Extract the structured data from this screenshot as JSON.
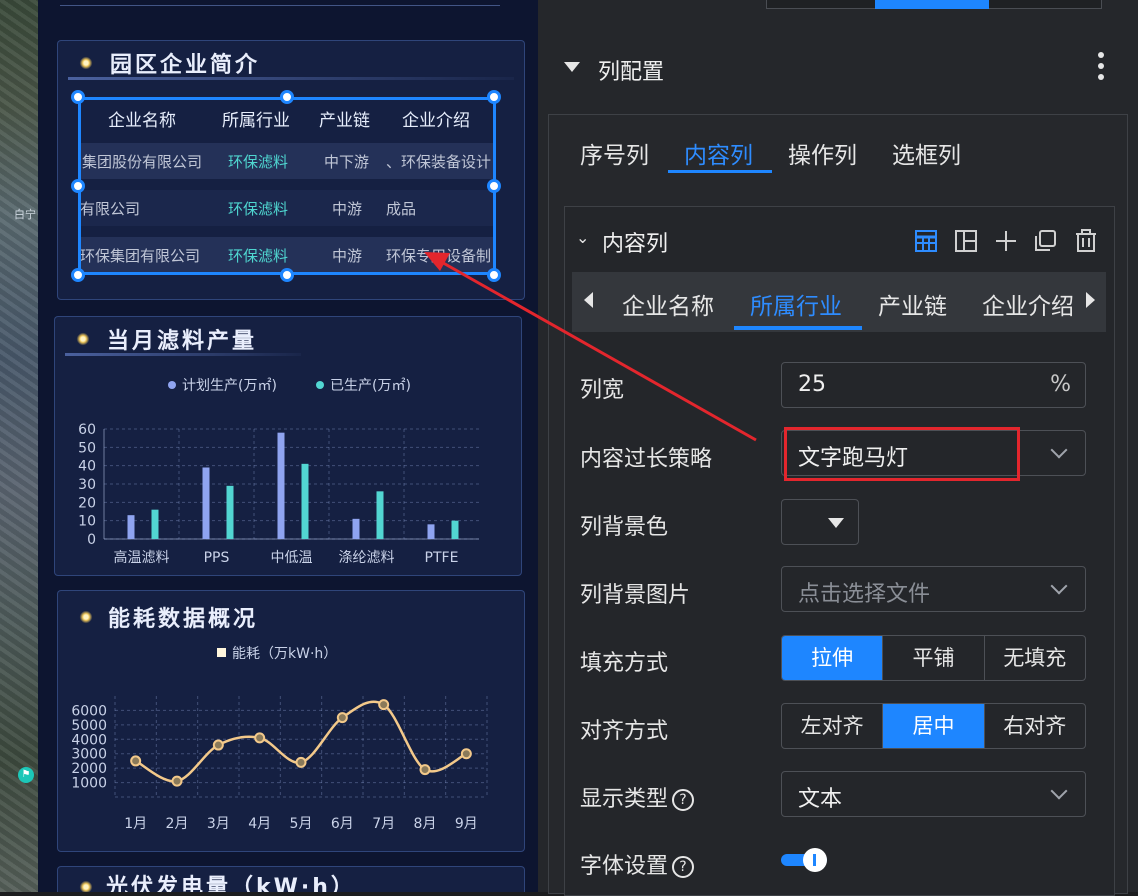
{
  "canvas": {
    "map_label": "白宁",
    "map_pin_glyph": "⚑",
    "company_panel": {
      "title": "园区企业简介",
      "headers": [
        "企业名称",
        "所属行业",
        "产业链",
        "企业介绍"
      ],
      "rows": [
        {
          "name": "集团股份有限公司",
          "industry": "环保滤料",
          "chain": "中下游",
          "intro": "、环保装备设计"
        },
        {
          "name": "有限公司",
          "industry": "环保滤料",
          "chain": "中游",
          "intro": "成品"
        },
        {
          "name": "环保集团有限公司",
          "industry": "环保滤料",
          "chain": "中游",
          "intro": "环保专用设备制"
        }
      ]
    },
    "filter_panel": {
      "title": "当月滤料产量"
    },
    "energy_panel": {
      "title": "能耗数据概况"
    },
    "pv_panel": {
      "title": "光伏发电量（kW·h）"
    }
  },
  "chart_data": [
    {
      "type": "bar",
      "legend_placement": "top",
      "categories": [
        "高温滤料",
        "PPS",
        "中低温",
        "涤纶滤料",
        "PTFE"
      ],
      "series": [
        {
          "name": "计划生产(万㎡)",
          "color": "#8fa4f0",
          "values": [
            13,
            39,
            58,
            11,
            8
          ]
        },
        {
          "name": "已生产(万㎡)",
          "color": "#52d6d2",
          "values": [
            16,
            29,
            41,
            26,
            10
          ]
        }
      ],
      "ylim": [
        0,
        60
      ],
      "yticks": [
        0,
        10,
        20,
        30,
        40,
        50,
        60
      ],
      "grid": true
    },
    {
      "type": "line",
      "legend_placement": "top",
      "categories": [
        "1月",
        "2月",
        "3月",
        "4月",
        "5月",
        "6月",
        "7月",
        "8月",
        "9月"
      ],
      "series": [
        {
          "name": "能耗（万kW·h）",
          "color": "#f3c98a",
          "values": [
            2500,
            1100,
            3600,
            4100,
            2400,
            5500,
            6400,
            1900,
            3000
          ]
        }
      ],
      "ylim": [
        0,
        7000
      ],
      "yticks": [
        1000,
        2000,
        3000,
        4000,
        5000,
        6000
      ],
      "grid": true
    }
  ],
  "config": {
    "section_title": "列配置",
    "tabs": [
      {
        "label": "序号列"
      },
      {
        "label": "内容列"
      },
      {
        "label": "操作列"
      },
      {
        "label": "选框列"
      }
    ],
    "inner_title": "内容列",
    "column_tabs": [
      {
        "label": "企业名称"
      },
      {
        "label": "所属行业"
      },
      {
        "label": "产业链"
      },
      {
        "label": "企业介绍"
      }
    ],
    "fields": {
      "width_label": "列宽",
      "width_value": "25",
      "width_unit": "%",
      "overflow_label": "内容过长策略",
      "overflow_value": "文字跑马灯",
      "bg_color_label": "列背景色",
      "bg_image_label": "列背景图片",
      "bg_image_placeholder": "点击选择文件",
      "fill_label": "填充方式",
      "fill_options": [
        "拉伸",
        "平铺",
        "无填充"
      ],
      "align_label": "对齐方式",
      "align_options": [
        "左对齐",
        "居中",
        "右对齐"
      ],
      "display_label": "显示类型",
      "display_value": "文本",
      "font_label": "字体设置",
      "help_glyph": "?"
    }
  }
}
